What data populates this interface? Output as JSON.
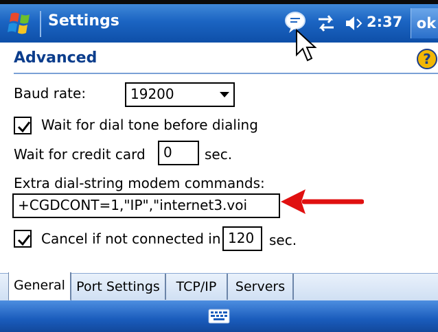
{
  "titlebar": {
    "title": "Settings",
    "clock": "2:37",
    "ok_label": "ok"
  },
  "heading": {
    "title": "Advanced"
  },
  "form": {
    "baud_rate_label": "Baud rate:",
    "baud_rate_value": "19200",
    "dial_tone_label": "Wait for dial tone before dialing",
    "dial_tone_checked": true,
    "credit_card_label": "Wait for credit card",
    "credit_card_value": "0",
    "credit_card_unit": "sec.",
    "extra_label": "Extra dial-string modem commands:",
    "extra_value": "+CGDCONT=1,\"IP\",\"internet3.voi",
    "cancel_label": "Cancel if not connected in",
    "cancel_checked": true,
    "cancel_value": "120",
    "cancel_unit": "sec."
  },
  "tabs": [
    {
      "label": "General"
    },
    {
      "label": "Port Settings"
    },
    {
      "label": "TCP/IP"
    },
    {
      "label": "Servers"
    }
  ],
  "colors": {
    "titlebar": "#1b64c2",
    "heading_text": "#0b3d8c",
    "arrow": "#e01010"
  }
}
